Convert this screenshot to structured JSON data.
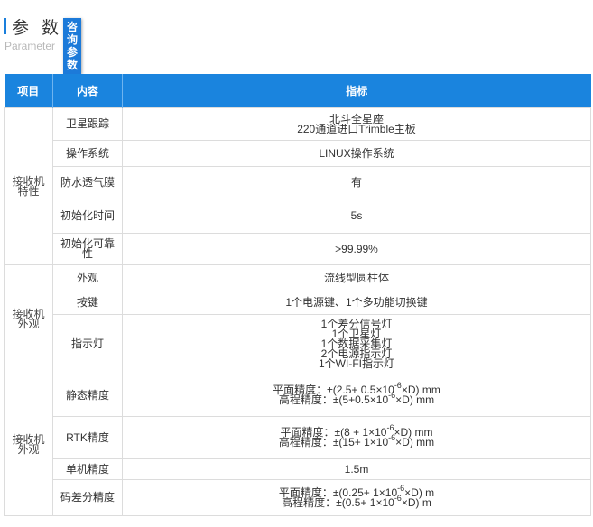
{
  "header": {
    "title": "参 数",
    "badge": "咨询参数",
    "subtitle": "Parameter"
  },
  "table": {
    "columns": [
      "项目",
      "内容",
      "指标"
    ],
    "groups": [
      {
        "label": "接收机特性",
        "rows": [
          {
            "content": "卫星跟踪",
            "values": [
              "北斗全星座",
              "220通道进口Trimble主板"
            ]
          },
          {
            "content": "操作系统",
            "values": [
              "LINUX操作系统"
            ]
          },
          {
            "content": "防水透气膜",
            "values": [
              "有"
            ]
          },
          {
            "content": "初始化时间",
            "values": [
              "5s"
            ]
          },
          {
            "content": "初始化可靠性",
            "values": [
              ">99.99%"
            ]
          }
        ]
      },
      {
        "label": "接收机外观",
        "rows": [
          {
            "content": "外观",
            "values": [
              "流线型圆柱体"
            ]
          },
          {
            "content": "按键",
            "values": [
              "1个电源键、1个多功能切换键"
            ]
          },
          {
            "content": "指示灯",
            "values": [
              "1个差分信号灯",
              "1个卫星灯",
              "1个数据采集灯",
              "2个电源指示灯",
              "1个WI-FI指示灯"
            ]
          }
        ]
      },
      {
        "label": "接收机外观",
        "rows": [
          {
            "content": "静态精度",
            "values": [
              {
                "pre": "平面精度：±(2.5+ 0.5×10",
                "sup": "-6",
                "post": "×D) mm"
              },
              {
                "pre": "高程精度：±(5+0.5×10",
                "sup": "-6",
                "post": "×D) mm"
              }
            ]
          },
          {
            "content": "RTK精度",
            "values": [
              {
                "pre": "平面精度：±(8 + 1×10",
                "sup": "-6",
                "post": "×D) mm"
              },
              {
                "pre": "高程精度：±(15+ 1×10",
                "sup": "-6",
                "post": "×D) mm"
              }
            ]
          },
          {
            "content": "单机精度",
            "values": [
              "1.5m"
            ]
          },
          {
            "content": "码差分精度",
            "values": [
              {
                "pre": "平面精度：±(0.25+ 1×10",
                "sup": "-6",
                "post": "×D) m"
              },
              {
                "pre": "高程精度：±(0.5+ 1×10",
                "sup": "-6",
                "post": "×D) m"
              }
            ]
          }
        ]
      }
    ]
  }
}
